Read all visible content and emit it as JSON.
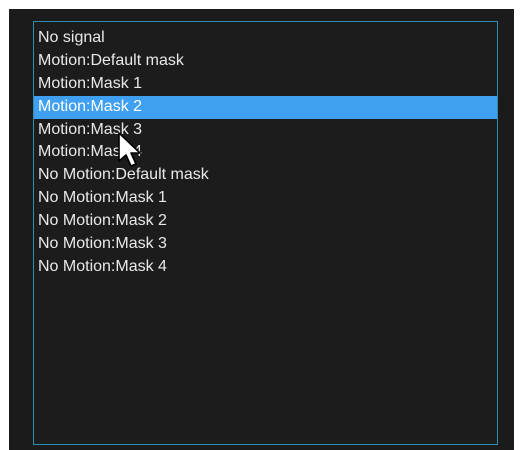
{
  "list": {
    "items": [
      {
        "label": "No signal",
        "selected": false
      },
      {
        "label": "Motion:Default mask",
        "selected": false
      },
      {
        "label": "Motion:Mask 1",
        "selected": false
      },
      {
        "label": "Motion:Mask 2",
        "selected": true
      },
      {
        "label": "Motion:Mask 3",
        "selected": false
      },
      {
        "label": "Motion:Mask 4",
        "selected": false
      },
      {
        "label": "No Motion:Default mask",
        "selected": false
      },
      {
        "label": "No Motion:Mask 1",
        "selected": false
      },
      {
        "label": "No Motion:Mask 2",
        "selected": false
      },
      {
        "label": "No Motion:Mask 3",
        "selected": false
      },
      {
        "label": "No Motion:Mask 4",
        "selected": false
      }
    ],
    "selected_index": 3
  },
  "colors": {
    "panel_background": "#1b1b1b",
    "list_border": "#2c8fb0",
    "selection_highlight": "#3fa0f2",
    "text": "#e9e9e9"
  },
  "cursor": {
    "icon": "mouse-pointer-icon"
  }
}
